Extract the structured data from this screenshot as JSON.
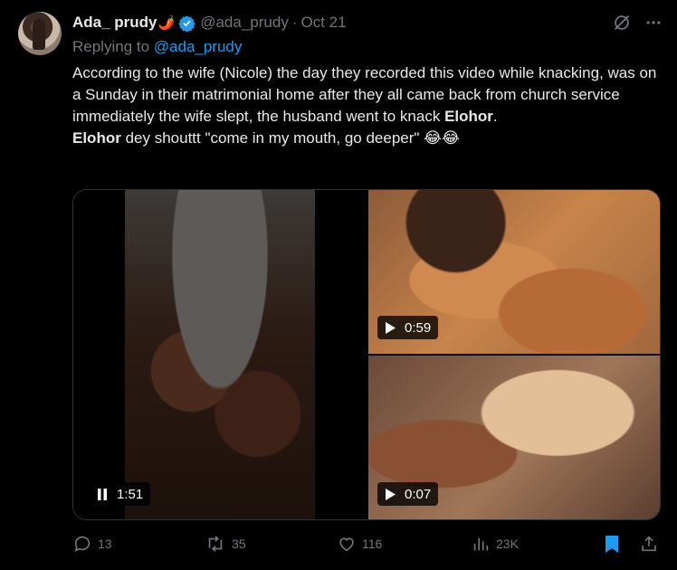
{
  "author": {
    "display_name": "Ada_ prudy",
    "emoji": "🌶️",
    "handle": "@ada_prudy",
    "separator": "·",
    "date": "Oct 21"
  },
  "reply": {
    "prefix": "Replying to ",
    "mention": "@ada_prudy"
  },
  "tweet": {
    "line1": "According to the wife (Nicole) the day they recorded this video while knacking, was on a Sunday in their matrimonial home after they all came back from church service immediately the wife slept, the husband went to knack ",
    "bold1": "Elohor",
    "end1": ".",
    "bold2": "Elohor",
    "line2": " dey shouttt \"come in my mouth, go deeper\" 😂😂"
  },
  "media": {
    "video1_time": "1:51",
    "video2_time": "0:59",
    "video3_time": "0:07"
  },
  "actions": {
    "replies": "13",
    "reposts": "35",
    "likes": "116",
    "views": "23K"
  },
  "colors": {
    "background": "#000000",
    "text": "#e7e9ea",
    "secondary": "#71767b",
    "accent": "#1d9bf0"
  }
}
